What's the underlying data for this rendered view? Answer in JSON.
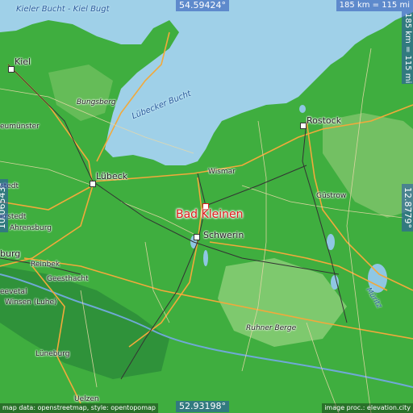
{
  "map": {
    "top_coord": "54.59424°",
    "bottom_coord": "52.93198°",
    "left_coord": "10.06543°",
    "right_coord": "12.8779°",
    "scale_horizontal": "185 km = 115 mi",
    "scale_vertical": "185 km = 115 mi",
    "attribution_left": "map data: openstreetmap, style: opentopomap",
    "attribution_right": "image proc.: elevation.city",
    "highlight_city": "Bad Kleinen",
    "colors": {
      "sea": "#9fd0e8",
      "land": "#3aa83a",
      "highland": "#86c870",
      "road": "#f2a93b",
      "rail": "#333333",
      "accent": "#e01a1a"
    }
  },
  "places": {
    "kieler_bucht": "Kieler Bucht - Kiel Bugt",
    "kiel": "Kiel",
    "bungsberg": "Bungsberg",
    "neumunster": "eumünster",
    "lubecker_bucht": "Lübecker Bucht",
    "lubeck": "Lübeck",
    "wismar": "Wismar",
    "rostock": "Rostock",
    "gustrow": "Güstrow",
    "stedt": "stedt",
    "stedt2": "erstedt",
    "ahrensburg": "Ahrensburg",
    "schwerin": "Schwerin",
    "hamburg": "burg",
    "reinbek": "Reinbek",
    "geesthacht": "Geesthacht",
    "seevetal": "eevetal",
    "winsen": "Winsen (Luhe)",
    "ruhner_berge": "Ruhner Berge",
    "muritz": "Müritz",
    "luneburg": "Lüneburg",
    "uelzen": "Uelzen"
  }
}
